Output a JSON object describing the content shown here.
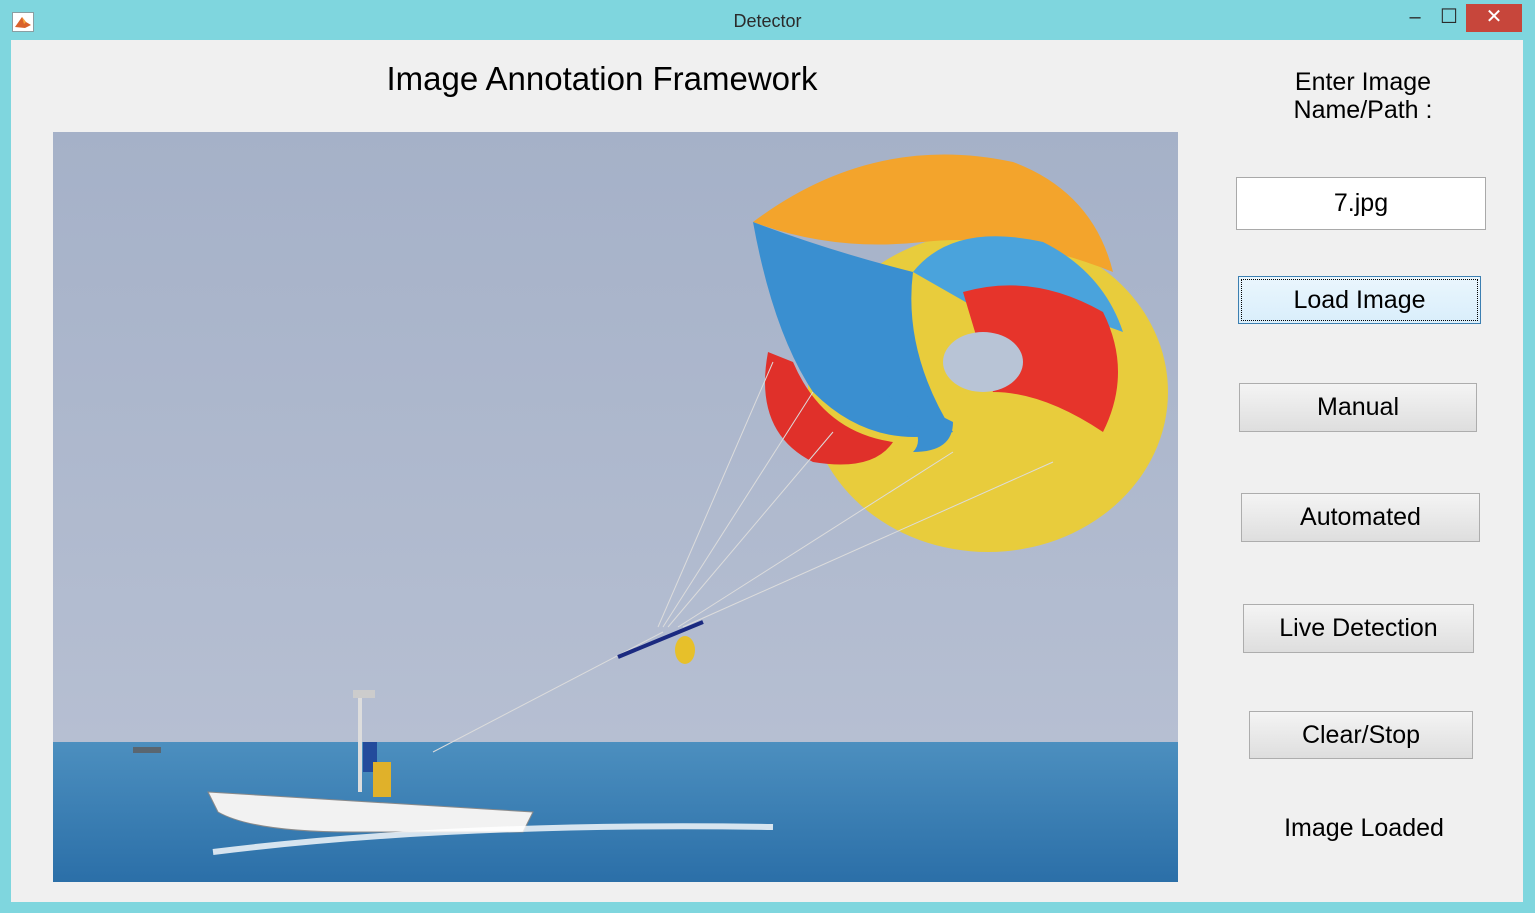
{
  "window": {
    "title": "Detector",
    "controls": {
      "minimize": "–",
      "maximize": "☐",
      "close": "✕"
    },
    "accent_color": "#7fd6de",
    "close_color": "#c7463b"
  },
  "main": {
    "heading": "Image Annotation Framework",
    "image_description_icon": "parasailing-photo"
  },
  "sidebar": {
    "prompt_label": "Enter Image\nName/Path :",
    "path_input_value": "7.jpg",
    "buttons": {
      "load": "Load Image",
      "manual": "Manual",
      "automated": "Automated",
      "live": "Live Detection",
      "clear": "Clear/Stop"
    },
    "status": "Image Loaded"
  }
}
